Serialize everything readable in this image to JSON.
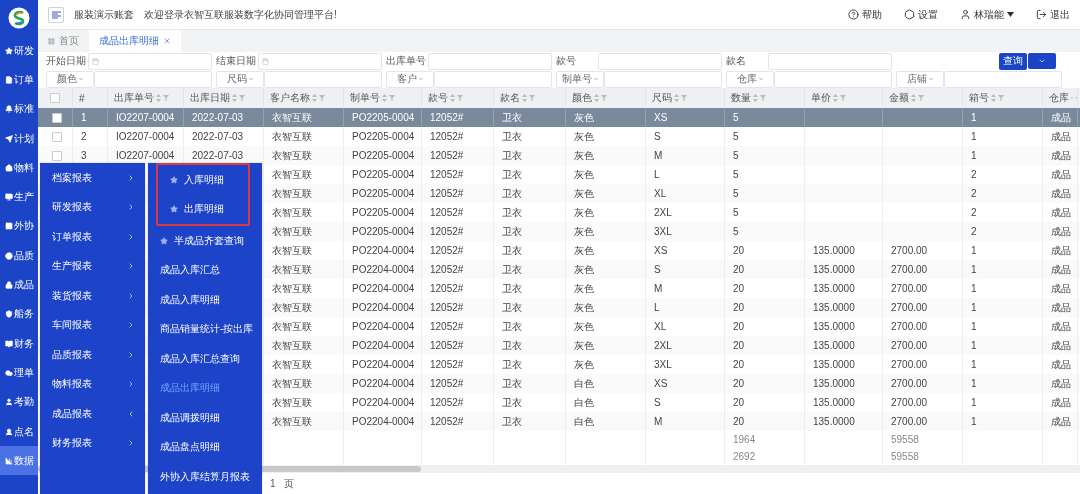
{
  "rail": {
    "items": [
      {
        "label": "研发",
        "selected": false
      },
      {
        "label": "订单",
        "selected": false
      },
      {
        "label": "标准",
        "selected": false
      },
      {
        "label": "计划",
        "selected": false
      },
      {
        "label": "物料",
        "selected": false
      },
      {
        "label": "生产",
        "selected": false
      },
      {
        "label": "外协",
        "selected": false
      },
      {
        "label": "品质",
        "selected": false
      },
      {
        "label": "成品",
        "selected": false
      },
      {
        "label": "船务",
        "selected": false
      },
      {
        "label": "财务",
        "selected": false
      },
      {
        "label": "理单",
        "selected": false
      },
      {
        "label": "考勤",
        "selected": false
      },
      {
        "label": "点名",
        "selected": false
      },
      {
        "label": "数据",
        "selected": true
      }
    ]
  },
  "header": {
    "account": "服装演示账套",
    "welcome": "欢迎登录衣智互联服装数字化协同管理平台!",
    "actions": [
      {
        "kind": "help",
        "label": "帮助"
      },
      {
        "kind": "settings",
        "label": "设置"
      },
      {
        "kind": "user",
        "label": "林瑞能"
      },
      {
        "kind": "logout",
        "label": "退出"
      }
    ]
  },
  "tabs": [
    {
      "label": "首页",
      "selected": false,
      "closable": false
    },
    {
      "label": "成品出库明细",
      "selected": true,
      "closable": true
    }
  ],
  "filters": {
    "row_1": [
      {
        "label": "开始日期",
        "kind": "date"
      },
      {
        "label": "结束日期",
        "kind": "date"
      },
      {
        "label": "出库单号",
        "kind": "text"
      },
      {
        "label": "款号",
        "kind": "text"
      },
      {
        "label": "款名",
        "kind": "text"
      }
    ],
    "row_2": [
      "颜色",
      "尺码",
      "客户",
      "制单号",
      "仓库",
      "店铺"
    ],
    "search_button": "查询"
  },
  "table": {
    "columns": [
      "#",
      "出库单号",
      "出库日期",
      "客户名称",
      "制单号",
      "款号",
      "款名",
      "颜色",
      "尺码",
      "数量",
      "单价",
      "金额",
      "箱号",
      "仓库"
    ],
    "all_checked": false,
    "rows": [
      {
        "selected": true,
        "checked": false,
        "index": "1",
        "out_no": "IO2207-0004",
        "out_date": "2022-07-03",
        "customer": "衣智互联",
        "order_no": "PO2205-0004",
        "style_no": "12052#",
        "style_name": "卫衣",
        "color_name": "灰色",
        "size": "XS",
        "qty": "5",
        "box_no": "1",
        "warehouse": "成品"
      },
      {
        "selected": false,
        "checked": false,
        "index": "2",
        "out_no": "IO2207-0004",
        "out_date": "2022-07-03",
        "customer": "衣智互联",
        "order_no": "PO2205-0004",
        "style_no": "12052#",
        "style_name": "卫衣",
        "color_name": "灰色",
        "size": "S",
        "qty": "5",
        "box_no": "1",
        "warehouse": "成品"
      },
      {
        "selected": false,
        "checked": false,
        "index": "3",
        "out_no": "IO2207-0004",
        "out_date": "2022-07-03",
        "customer": "衣智互联",
        "order_no": "PO2205-0004",
        "style_no": "12052#",
        "style_name": "卫衣",
        "color_name": "灰色",
        "size": "M",
        "qty": "5",
        "box_no": "1",
        "warehouse": "成品"
      },
      {
        "selected": false,
        "customer": "衣智互联",
        "order_no": "PO2205-0004",
        "style_no": "12052#",
        "style_name": "卫衣",
        "color_name": "灰色",
        "size": "L",
        "qty": "5",
        "box_no": "2",
        "warehouse": "成品"
      },
      {
        "selected": false,
        "customer": "衣智互联",
        "order_no": "PO2205-0004",
        "style_no": "12052#",
        "style_name": "卫衣",
        "color_name": "灰色",
        "size": "XL",
        "qty": "5",
        "box_no": "2",
        "warehouse": "成品"
      },
      {
        "selected": false,
        "customer": "衣智互联",
        "order_no": "PO2205-0004",
        "style_no": "12052#",
        "style_name": "卫衣",
        "color_name": "灰色",
        "size": "2XL",
        "qty": "5",
        "box_no": "2",
        "warehouse": "成品"
      },
      {
        "selected": false,
        "customer": "衣智互联",
        "order_no": "PO2205-0004",
        "style_no": "12052#",
        "style_name": "卫衣",
        "color_name": "灰色",
        "size": "3XL",
        "qty": "5",
        "box_no": "2",
        "warehouse": "成品"
      },
      {
        "selected": false,
        "customer": "衣智互联",
        "order_no": "PO2204-0004",
        "style_no": "12052#",
        "style_name": "卫衣",
        "color_name": "灰色",
        "size": "XS",
        "qty": "20",
        "unit_price": "135.0000",
        "amount": "2700.00",
        "box_no": "1",
        "warehouse": "成品"
      },
      {
        "selected": false,
        "customer": "衣智互联",
        "order_no": "PO2204-0004",
        "style_no": "12052#",
        "style_name": "卫衣",
        "color_name": "灰色",
        "size": "S",
        "qty": "20",
        "unit_price": "135.0000",
        "amount": "2700.00",
        "box_no": "1",
        "warehouse": "成品"
      },
      {
        "selected": false,
        "customer": "衣智互联",
        "order_no": "PO2204-0004",
        "style_no": "12052#",
        "style_name": "卫衣",
        "color_name": "灰色",
        "size": "M",
        "qty": "20",
        "unit_price": "135.0000",
        "amount": "2700.00",
        "box_no": "1",
        "warehouse": "成品"
      },
      {
        "selected": false,
        "customer": "衣智互联",
        "order_no": "PO2204-0004",
        "style_no": "12052#",
        "style_name": "卫衣",
        "color_name": "灰色",
        "size": "L",
        "qty": "20",
        "unit_price": "135.0000",
        "amount": "2700.00",
        "box_no": "1",
        "warehouse": "成品"
      },
      {
        "selected": false,
        "customer": "衣智互联",
        "order_no": "PO2204-0004",
        "style_no": "12052#",
        "style_name": "卫衣",
        "color_name": "灰色",
        "size": "XL",
        "qty": "20",
        "unit_price": "135.0000",
        "amount": "2700.00",
        "box_no": "1",
        "warehouse": "成品"
      },
      {
        "selected": false,
        "customer": "衣智互联",
        "order_no": "PO2204-0004",
        "style_no": "12052#",
        "style_name": "卫衣",
        "color_name": "灰色",
        "size": "2XL",
        "qty": "20",
        "unit_price": "135.0000",
        "amount": "2700.00",
        "box_no": "1",
        "warehouse": "成品"
      },
      {
        "selected": false,
        "customer": "衣智互联",
        "order_no": "PO2204-0004",
        "style_no": "12052#",
        "style_name": "卫衣",
        "color_name": "灰色",
        "size": "3XL",
        "qty": "20",
        "unit_price": "135.0000",
        "amount": "2700.00",
        "box_no": "1",
        "warehouse": "成品"
      },
      {
        "selected": false,
        "customer": "衣智互联",
        "order_no": "PO2204-0004",
        "style_no": "12052#",
        "style_name": "卫衣",
        "color_name": "白色",
        "size": "XS",
        "qty": "20",
        "unit_price": "135.0000",
        "amount": "2700.00",
        "box_no": "1",
        "warehouse": "成品"
      },
      {
        "selected": false,
        "customer": "衣智互联",
        "order_no": "PO2204-0004",
        "style_no": "12052#",
        "style_name": "卫衣",
        "color_name": "白色",
        "size": "S",
        "qty": "20",
        "unit_price": "135.0000",
        "amount": "2700.00",
        "box_no": "1",
        "warehouse": "成品"
      },
      {
        "selected": false,
        "customer": "衣智互联",
        "order_no": "PO2204-0004",
        "style_no": "12052#",
        "style_name": "卫衣",
        "color_name": "白色",
        "size": "M",
        "qty": "20",
        "unit_price": "135.0000",
        "amount": "2700.00",
        "box_no": "1",
        "warehouse": "成品"
      }
    ],
    "summary": [
      {
        "qty": "1964",
        "amount": "59558"
      },
      {
        "qty": "2692",
        "amount": "59558"
      }
    ]
  },
  "pager": {
    "page": "1",
    "unit": "页"
  },
  "report_menu": {
    "categories": [
      {
        "label": "档案报表",
        "expanded": false
      },
      {
        "label": "研发报表",
        "expanded": false
      },
      {
        "label": "订单报表",
        "expanded": false
      },
      {
        "label": "生产报表",
        "expanded": false
      },
      {
        "label": "装货报表",
        "expanded": false
      },
      {
        "label": "车间报表",
        "expanded": false
      },
      {
        "label": "品质报表",
        "expanded": false
      },
      {
        "label": "物料报表",
        "expanded": false
      },
      {
        "label": "成品报表",
        "expanded": true
      },
      {
        "label": "财务报表",
        "expanded": false
      }
    ],
    "items": [
      {
        "label": "入库明细",
        "starred": true,
        "highlighted": true,
        "selected": false
      },
      {
        "label": "出库明细",
        "starred": true,
        "highlighted": true,
        "selected": false
      },
      {
        "label": "半成品齐套查询",
        "starred": true,
        "highlighted": false,
        "selected": false
      },
      {
        "label": "成品入库汇总",
        "starred": false,
        "highlighted": false,
        "selected": false
      },
      {
        "label": "成品入库明细",
        "starred": false,
        "highlighted": false,
        "selected": false
      },
      {
        "label": "商品销量统计-按出库",
        "starred": false,
        "highlighted": false,
        "selected": false
      },
      {
        "label": "成品入库汇总查询",
        "starred": false,
        "highlighted": false,
        "selected": false
      },
      {
        "label": "成品出库明细",
        "starred": false,
        "highlighted": false,
        "selected": true
      },
      {
        "label": "成品调拨明细",
        "starred": false,
        "highlighted": false,
        "selected": false
      },
      {
        "label": "成品盘点明细",
        "starred": false,
        "highlighted": false,
        "selected": false
      },
      {
        "label": "外协入库结算月报表",
        "starred": false,
        "highlighted": false,
        "selected": false
      }
    ]
  }
}
